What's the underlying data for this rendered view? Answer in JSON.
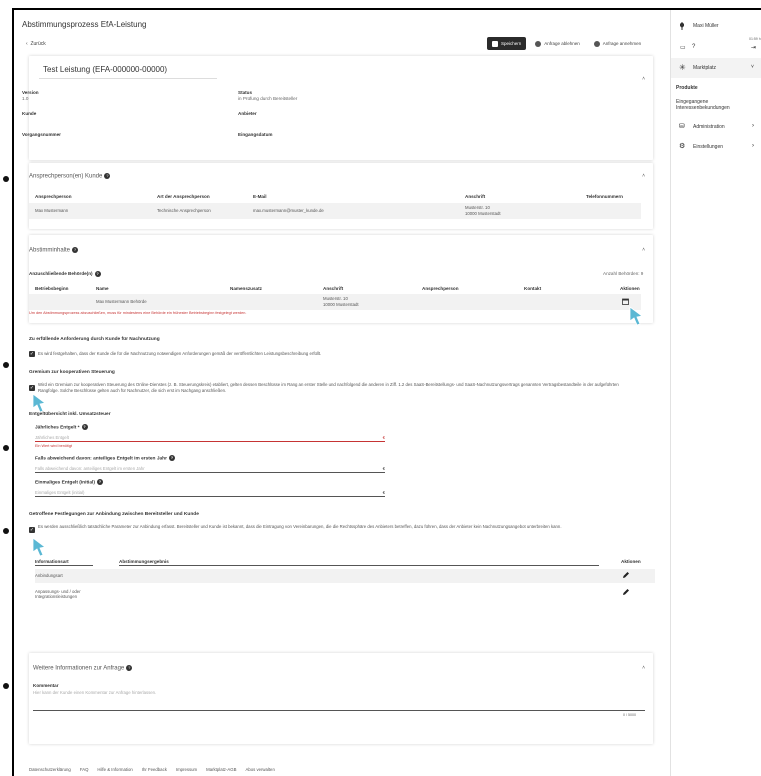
{
  "header": {
    "title": "Abstimmungsprozess EfA-Leistung",
    "back_label": "Zurück",
    "buttons": {
      "save": "Speichern",
      "reject": "Anfrage ablehnen",
      "accept": "Anfrage annehmen"
    }
  },
  "user": {
    "name": "Maxi Müller",
    "time": "01:59 h"
  },
  "sidebar": {
    "section": "Marktplatz",
    "items": [
      {
        "label": "Produkte"
      },
      {
        "label": "Eingegangene Interessenbekundungen"
      },
      {
        "label": "Administration"
      },
      {
        "label": "Einstellungen"
      }
    ]
  },
  "overview": {
    "title": "Test Leistung (EFA-000000-00000)",
    "version_label": "Version",
    "version_value": "1.0",
    "status_label": "Status",
    "status_value": "in Prüfung durch Bereitsteller",
    "kunde_label": "Kunde",
    "anbieter_label": "Anbieter",
    "vorgangsnummer_label": "Vorgangsnummer",
    "eingangsdatum_label": "Eingangsdatum"
  },
  "contacts": {
    "title": "Ansprechperson(en) Kunde",
    "headers": [
      "Ansprechperson",
      "Art der Ansprechperson",
      "E-Mail",
      "Anschrift",
      "Telefonnummern"
    ],
    "row": {
      "name": "Max Mustermann",
      "type": "Technische Ansprechperson",
      "email": "max.mustermann@muster_kunde.de",
      "address1": "Musterstr. 10",
      "address2": "10000 Musterstadt"
    }
  },
  "abstimmung": {
    "title": "Abstimminhalte",
    "authorities_label": "Anzuschließende Behörde(n)",
    "count_label": "Anzahl Behörden: 9",
    "headers": [
      "Betriebsbeginn",
      "Name",
      "Namenszusatz",
      "Anschrift",
      "Ansprechperson",
      "Kontakt",
      "Aktionen"
    ],
    "row": {
      "name": "Max Mustermann Behörde",
      "address1": "Musterstr. 10",
      "address2": "10000 Musterstadt"
    },
    "error_hint": "Um den Abstimmungsprozess abzuschließen, muss für mindestens eine Behörde ein frühester Betriebsbeginn festgelegt werden."
  },
  "requirements": {
    "heading1": "Zu erfüllende Anforderung durch Kunde für Nachnutzung",
    "check1": "Es wird festgehalten, dass der Kunde die für die Nachnutzung notwendigen Anforderungen gemäß der veröffentlichten Leistungsbeschreibung erfüllt.",
    "heading2": "Gremium zur kooperativen Steuerung",
    "check2": "Wird ein Gremium zur kooperativen Steuerung des Online-Dienstes (z. B. Steuerungskreis) etabliert, gelten dessen Beschlüsse im Rang an erster Stelle und nachfolgend die anderen in Ziff. 1.2 des SaaS-Bereitstellungs- und SaaS-Nachnutzungsvertrags genannten Vertragsbestandteile in der aufgeführten Rangfolge. Solche Beschlüsse gelten auch für Nachnutzer, die sich erst im Nachgang anschließen.",
    "heading3": "Entgeltübersicht inkl. Umsatzsteuer",
    "field1_label": "Jährliches Entgelt *",
    "field1_placeholder": "Jährliches Entgelt",
    "field1_error": "Ein Wert wird benötigt",
    "field2_label": "Falls abweichend davon: anteiliges Entgelt im ersten Jahr",
    "field2_placeholder": "Falls abweichend davon: anteiliges Entgelt im ersten Jahr",
    "field3_label": "Einmaliges Entgelt (initial)",
    "field3_placeholder": "Einmaliges Entgelt (initial)",
    "currency": "€",
    "heading4": "Getroffene Festlegungen zur Anbindung zwischen Bereitsteller und Kunde",
    "check4": "Es werden ausschließlich tatsächliche Parameter zur Anbindung erfasst. Bereitsteller und Kunde ist bekannt, dass die Eintragung von Vereinbarungen, die die Rechtssphäre des Anbieters betreffen, dazu führen, dass der Anbieter kein Nachnutzungsangebot unterbreiten kann.",
    "table_headers": [
      "Informationsart",
      "Abstimmungsergebnis",
      "Aktionen"
    ],
    "rows": [
      {
        "info": "Anbindungsart"
      },
      {
        "info": "Anpassungs- und / oder Integrationsleistungen"
      }
    ]
  },
  "further": {
    "title": "Weitere Informationen zur Anfrage",
    "comment_label": "Kommentar",
    "comment_placeholder": "Hier kann der Kunde einen Kommentar zur Anfrage hinterlassen.",
    "counter": "0 / 5000"
  },
  "footer": {
    "links": [
      "Datenschutzerklärung",
      "FAQ",
      "Hilfe & Information",
      "Ihr Feedback",
      "Impressum",
      "Marktplatz-AGB",
      "Abos verwalten"
    ]
  }
}
